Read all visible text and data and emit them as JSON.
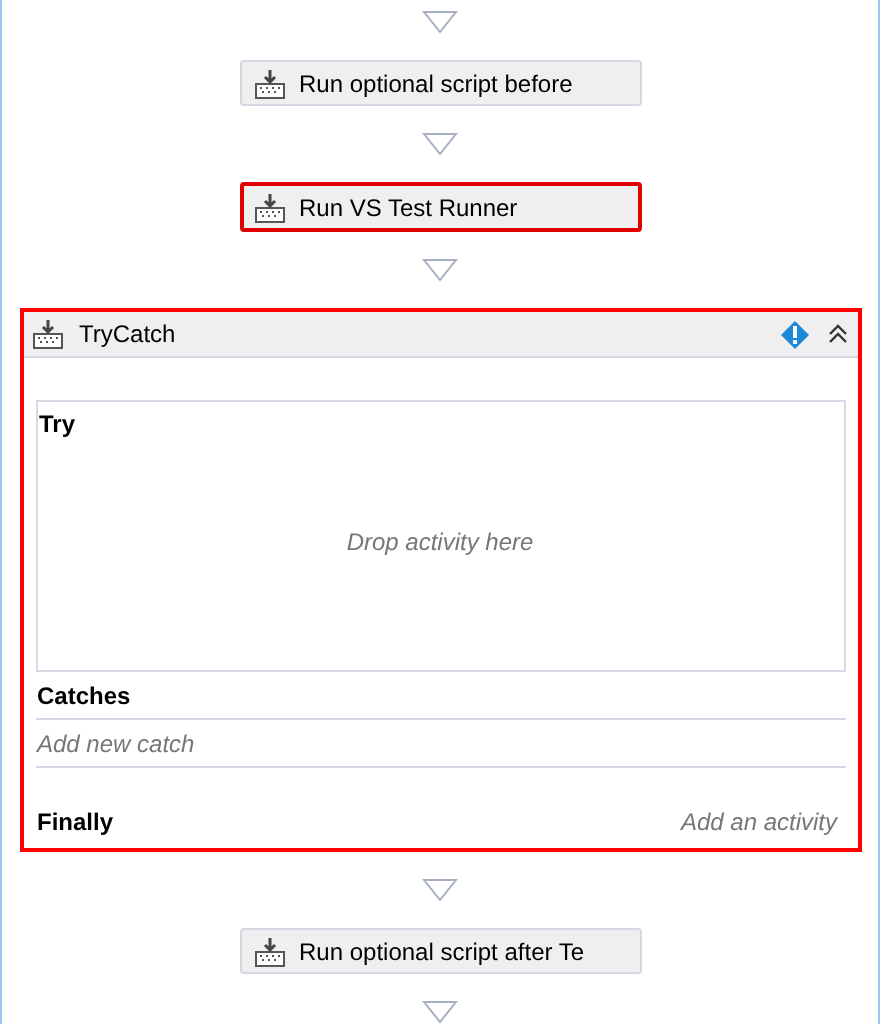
{
  "flow": [
    {
      "kind": "activity",
      "label": "Run optional script before",
      "selected": false
    },
    {
      "kind": "activity",
      "label": "Run VS Test Runner",
      "selected": true
    },
    {
      "kind": "trycatch",
      "title": "TryCatch",
      "selected": true,
      "try": {
        "label": "Try",
        "placeholder": "Drop activity here"
      },
      "catches": {
        "label": "Catches",
        "placeholder": "Add new catch"
      },
      "finally": {
        "label": "Finally",
        "placeholder": "Add an activity"
      }
    },
    {
      "kind": "activity",
      "label": "Run optional script after Te",
      "selected": false
    }
  ]
}
